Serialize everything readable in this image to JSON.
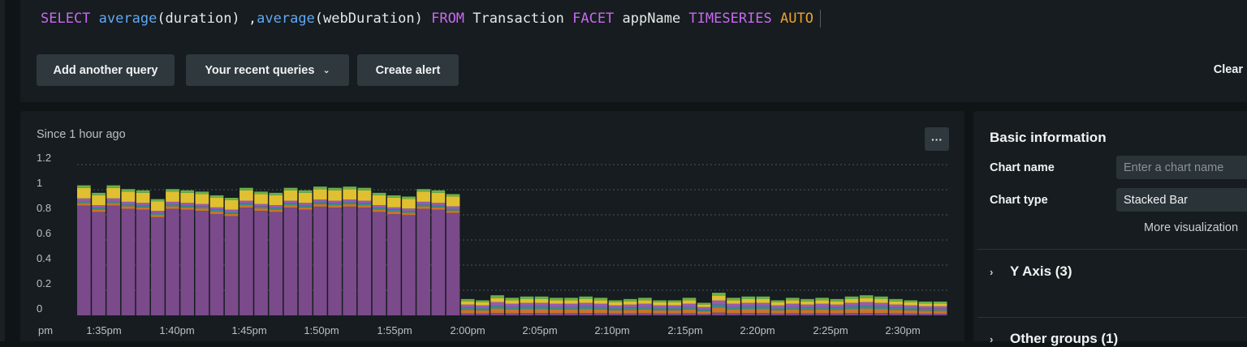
{
  "query": {
    "tokens": [
      {
        "text": "SELECT ",
        "cls": "kw"
      },
      {
        "text": "average",
        "cls": "fn"
      },
      {
        "text": "(duration) ,",
        "cls": "plain"
      },
      {
        "text": "average",
        "cls": "fn"
      },
      {
        "text": "(webDuration) ",
        "cls": "plain"
      },
      {
        "text": "FROM ",
        "cls": "kw"
      },
      {
        "text": "Transaction ",
        "cls": "plain"
      },
      {
        "text": "FACET ",
        "cls": "kw"
      },
      {
        "text": "appName ",
        "cls": "plain"
      },
      {
        "text": "TIMESERIES ",
        "cls": "kw"
      },
      {
        "text": "AUTO",
        "cls": "auto"
      }
    ]
  },
  "toolbar": {
    "add_query": "Add another query",
    "recent_queries": "Your recent queries",
    "create_alert": "Create alert",
    "clear": "Clear"
  },
  "chart_panel": {
    "since": "Since 1 hour ago",
    "more": "···"
  },
  "chart_data": {
    "type": "bar",
    "stacked": true,
    "ylim": [
      0,
      1.2
    ],
    "yticks": [
      "0",
      "0.2",
      "0.4",
      "0.6",
      "0.8",
      "1",
      "1.2"
    ],
    "xtick_labels": [
      "pm",
      "1:35pm",
      "1:40pm",
      "1:45pm",
      "1:50pm",
      "1:55pm",
      "2:00pm",
      "2:05pm",
      "2:10pm",
      "2:15pm",
      "2:20pm",
      "2:25pm",
      "2:30pm"
    ],
    "grid": true,
    "totals": [
      1.04,
      0.98,
      1.04,
      1.01,
      1.0,
      0.93,
      1.01,
      1.0,
      0.99,
      0.96,
      0.94,
      1.02,
      0.99,
      0.98,
      1.02,
      1.0,
      1.03,
      1.02,
      1.03,
      1.02,
      0.98,
      0.96,
      0.95,
      1.01,
      1.0,
      0.97,
      0.13,
      0.12,
      0.16,
      0.14,
      0.15,
      0.15,
      0.14,
      0.14,
      0.15,
      0.14,
      0.12,
      0.13,
      0.14,
      0.12,
      0.12,
      0.14,
      0.1,
      0.18,
      0.14,
      0.15,
      0.15,
      0.12,
      0.14,
      0.13,
      0.14,
      0.13,
      0.15,
      0.16,
      0.15,
      0.13,
      0.12,
      0.11,
      0.11
    ],
    "segment_colors": [
      "#7a4a8a",
      "#c8742a",
      "#3a8a8a",
      "#9a5ab0",
      "#e0c030",
      "#6ab04a"
    ]
  },
  "side": {
    "title": "Basic information",
    "chart_name_label": "Chart name",
    "chart_name_placeholder": "Enter a chart name",
    "chart_type_label": "Chart type",
    "chart_type_value": "Stacked Bar",
    "more_vis": "More visualization",
    "y_axis": "Y Axis (3)",
    "other_groups": "Other groups (1)"
  }
}
